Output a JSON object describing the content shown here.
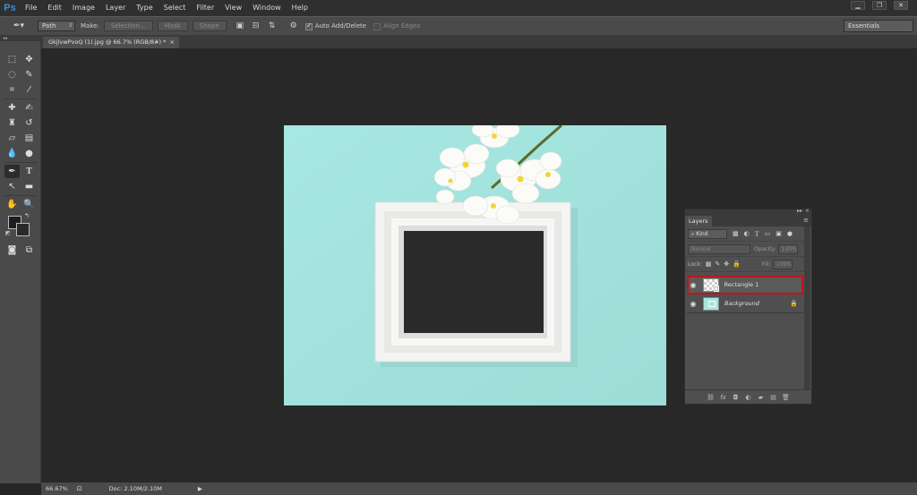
{
  "app": {
    "logo": "Ps"
  },
  "menu": [
    "File",
    "Edit",
    "Image",
    "Layer",
    "Type",
    "Select",
    "Filter",
    "View",
    "Window",
    "Help"
  ],
  "window_controls": {
    "minimize": "▁",
    "restore": "❐",
    "close": "✕"
  },
  "options": {
    "mode_value": "Path",
    "make_label": "Make:",
    "selection_button": "Selection...",
    "mask_button": "Mask",
    "shape_button": "Shape",
    "auto_add_delete_label": "Auto Add/Delete",
    "auto_add_delete_checked": true,
    "align_edges_label": "Align Edges",
    "align_edges_checked": false,
    "workspace_value": "Essentials"
  },
  "document": {
    "tab_title": "GkjlvwPvoQ (1).jpg @ 66.7% (RGB/8#) *",
    "tab_close": "×"
  },
  "status": {
    "zoom": "66.67%",
    "doc_info": "Doc: 2.10M/2.10M",
    "arrow": "▶"
  },
  "layers_panel": {
    "title": "Layers",
    "filter_kind": "Kind",
    "blend_mode": "Normal",
    "opacity_label": "Opacity:",
    "opacity_value": "100%",
    "lock_label": "Lock:",
    "fill_label": "Fill:",
    "fill_value": "100%",
    "layers": [
      {
        "name": "Rectangle 1",
        "selected": true,
        "locked": false
      },
      {
        "name": "Background",
        "selected": false,
        "locked": true
      }
    ]
  },
  "colors": {
    "accent_highlight": "#c0141c",
    "canvas_bg": "#a8e6e0",
    "ui_panel": "#4a4a4a"
  }
}
